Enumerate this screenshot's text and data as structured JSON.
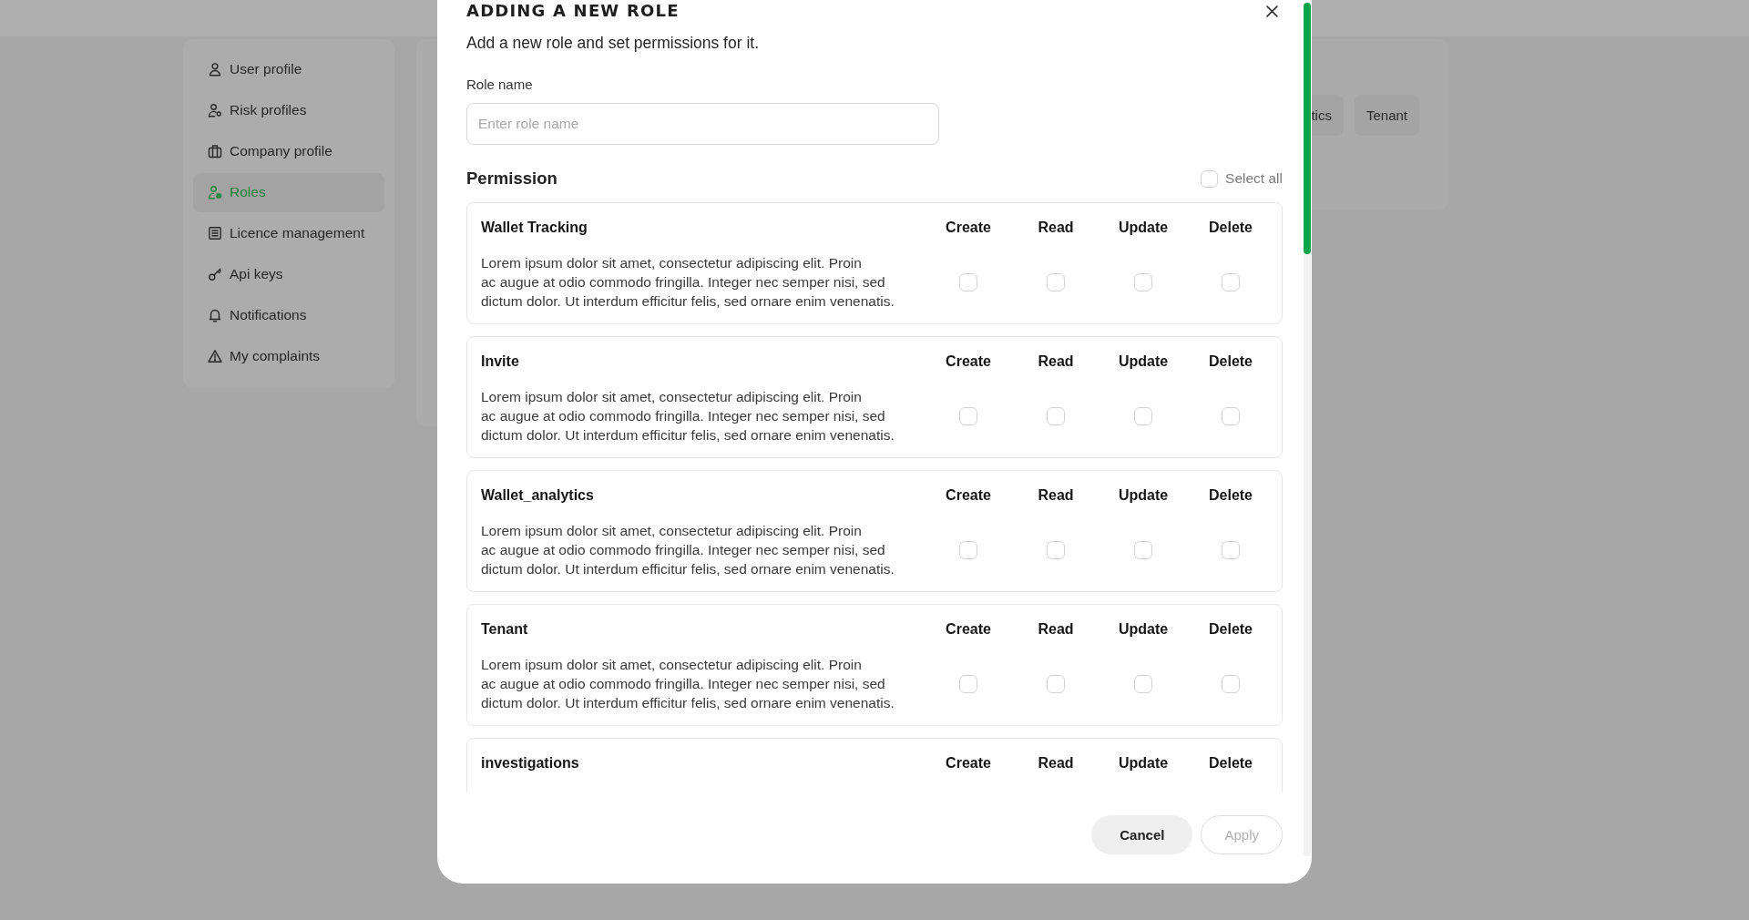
{
  "sidebar": {
    "items": [
      {
        "label": "User profile",
        "selected": false
      },
      {
        "label": "Risk profiles",
        "selected": false
      },
      {
        "label": "Company profile",
        "selected": false
      },
      {
        "label": "Roles",
        "selected": true
      },
      {
        "label": "Licence management",
        "selected": false
      },
      {
        "label": "Api keys",
        "selected": false
      },
      {
        "label": "Notifications",
        "selected": false
      },
      {
        "label": "My complaints",
        "selected": false
      }
    ]
  },
  "tabs": [
    {
      "label": "tics",
      "selected": false
    },
    {
      "label": "Tenant",
      "selected": false
    }
  ],
  "modal": {
    "title": "ADDING A NEW ROLE",
    "subtitle": "Add a new role and set permissions for it.",
    "role_name": {
      "label": "Role name",
      "placeholder": "Enter role name"
    },
    "permission_heading": "Permission",
    "select_all": {
      "label": "Select all",
      "checked": false
    },
    "permissions": [
      {
        "name": "Wallet Tracking",
        "description": "Lorem ipsum dolor sit amet, consectetur adipiscing elit. Proin\nac augue at odio commodo fringilla. Integer nec semper nisi, sed\ndictum dolor. Ut interdum efficitur felis, sed ornare enim venenatis.",
        "actions": [
          {
            "label": "Create",
            "checked": false
          },
          {
            "label": "Read",
            "checked": false
          },
          {
            "label": "Update",
            "checked": false
          },
          {
            "label": "Delete",
            "checked": false
          }
        ]
      },
      {
        "name": "Invite",
        "description": "Lorem ipsum dolor sit amet, consectetur adipiscing elit. Proin\nac augue at odio commodo fringilla. Integer nec semper nisi, sed\ndictum dolor. Ut interdum efficitur felis, sed ornare enim venenatis.",
        "actions": [
          {
            "label": "Create",
            "checked": false
          },
          {
            "label": "Read",
            "checked": false
          },
          {
            "label": "Update",
            "checked": false
          },
          {
            "label": "Delete",
            "checked": false
          }
        ]
      },
      {
        "name": "Wallet_analytics",
        "description": "Lorem ipsum dolor sit amet, consectetur adipiscing elit. Proin\nac augue at odio commodo fringilla. Integer nec semper nisi, sed\ndictum dolor. Ut interdum efficitur felis, sed ornare enim venenatis.",
        "actions": [
          {
            "label": "Create",
            "checked": false
          },
          {
            "label": "Read",
            "checked": false
          },
          {
            "label": "Update",
            "checked": false
          },
          {
            "label": "Delete",
            "checked": false
          }
        ]
      },
      {
        "name": "Tenant",
        "description": "Lorem ipsum dolor sit amet, consectetur adipiscing elit. Proin\nac augue at odio commodo fringilla. Integer nec semper nisi, sed\ndictum dolor. Ut interdum efficitur felis, sed ornare enim venenatis.",
        "actions": [
          {
            "label": "Create",
            "checked": false
          },
          {
            "label": "Read",
            "checked": false
          },
          {
            "label": "Update",
            "checked": false
          },
          {
            "label": "Delete",
            "checked": false
          }
        ]
      },
      {
        "name": "investigations",
        "actions": [
          {
            "label": "Create"
          },
          {
            "label": "Read"
          },
          {
            "label": "Update"
          },
          {
            "label": "Delete"
          }
        ]
      }
    ],
    "buttons": [
      {
        "label": "Cancel",
        "disabled": false
      },
      {
        "label": "Apply",
        "disabled": true
      }
    ]
  }
}
